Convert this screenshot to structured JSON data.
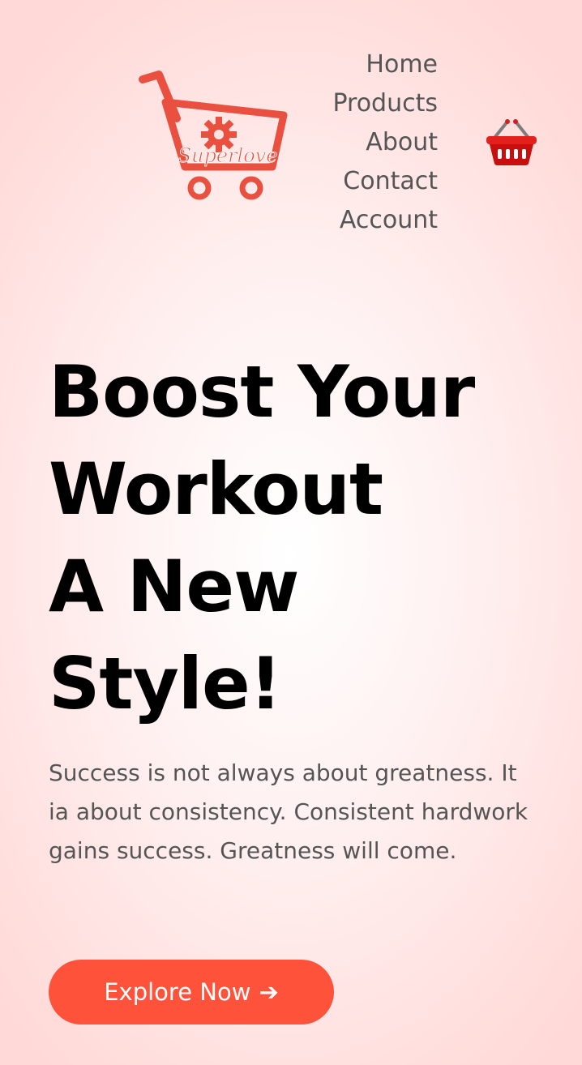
{
  "header": {
    "logo_text": "Superlove",
    "nav_items": [
      "Home",
      "Products",
      "About",
      "Contact",
      "Account"
    ],
    "cart_icon": "shopping-basket-icon"
  },
  "hero": {
    "headline_lines": [
      "Boost Your",
      "Workout",
      "A New",
      "Style!"
    ],
    "tagline": "Success is not always about greatness. It ia about consistency. Consistent hardwork gains success. Greatness will come.",
    "cta_label": "Explore Now",
    "cta_icon": "arrow-right-icon",
    "cta_arrow_glyph": "➔"
  },
  "colors": {
    "accent": "#ff523b",
    "heading": "#000000",
    "body_text": "#555555",
    "logo": "#e9503f"
  }
}
